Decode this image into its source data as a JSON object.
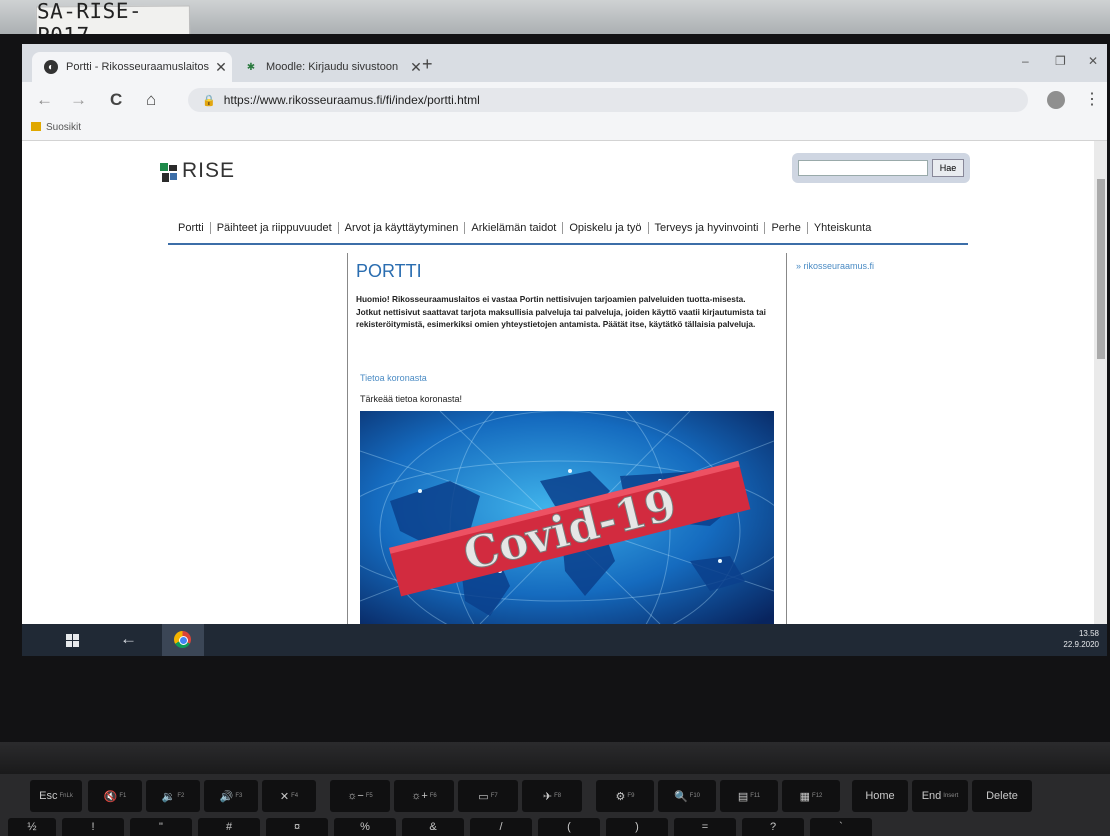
{
  "sticker_label": "SA-RISE-P017",
  "browser": {
    "tabs": [
      {
        "title": "Portti - Rikosseuraamuslaitos",
        "close": "✕"
      },
      {
        "title": "Moodle: Kirjaudu sivustoon",
        "close": "✕"
      }
    ],
    "new_tab": "+",
    "window_controls": {
      "minimize": "–",
      "maximize": "❐",
      "close": "✕"
    },
    "nav": {
      "back": "←",
      "forward": "→",
      "reload": "C",
      "home": "⌂"
    },
    "url": "https://www.rikosseuraamus.fi/fi/index/portti.html",
    "menu": "⋮",
    "bookmarks": [
      {
        "label": "Suosikit"
      }
    ]
  },
  "page": {
    "logo_text": "RISE",
    "search": {
      "placeholder": "",
      "button_label": "Hae"
    },
    "nav_items": [
      "Portti",
      "Päihteet ja riippuvuudet",
      "Arvot ja käyttäytyminen",
      "Arkielämän taidot",
      "Opiskelu ja työ",
      "Terveys ja hyvinvointi",
      "Perhe",
      "Yhteiskunta"
    ],
    "title": "PORTTI",
    "notice": "Huomio! Rikosseuraamuslaitos ei vastaa Portin nettisivujen tarjoamien palveluiden tuotta-misesta. Jotkut nettisivut saattavat tarjota maksullisia palveluja tai palveluja, joiden käyttö vaatii kirjautumista tai rekisteröitymistä, esimerkiksi omien yhteystietojen antamista. Päätät itse, käytätkö tällaisia palveluja.",
    "corona_link": "Tietoa koronasta",
    "corona_text": "Tärkeää tietoa koronasta!",
    "image_text": "Covid-19",
    "side_link": "» rikosseuraamus.fi"
  },
  "taskbar": {
    "back": "←",
    "time": "13.58",
    "date": "22.9.2020"
  },
  "keyboard": {
    "fn_keys": [
      {
        "label": "Esc",
        "sub": "FnLk"
      },
      {
        "label": "🔇",
        "sub": "F1"
      },
      {
        "label": "🔉",
        "sub": "F2"
      },
      {
        "label": "🔊",
        "sub": "F3"
      },
      {
        "label": "✕",
        "sub": "F4"
      },
      {
        "label": "☼−",
        "sub": "F5"
      },
      {
        "label": "☼+",
        "sub": "F6"
      },
      {
        "label": "▭",
        "sub": "F7"
      },
      {
        "label": "✈",
        "sub": "F8"
      },
      {
        "label": "⚙",
        "sub": "F9"
      },
      {
        "label": "🔍",
        "sub": "F10"
      },
      {
        "label": "▤",
        "sub": "F11"
      },
      {
        "label": "▦",
        "sub": "F12"
      },
      {
        "label": "Home",
        "sub": ""
      },
      {
        "label": "End",
        "sub": "Insert"
      },
      {
        "label": "Delete",
        "sub": ""
      }
    ],
    "row2": [
      "½",
      "!",
      "\"",
      "#",
      "¤",
      "%",
      "&",
      "/",
      "(",
      ")",
      "=",
      "?",
      "`"
    ]
  }
}
